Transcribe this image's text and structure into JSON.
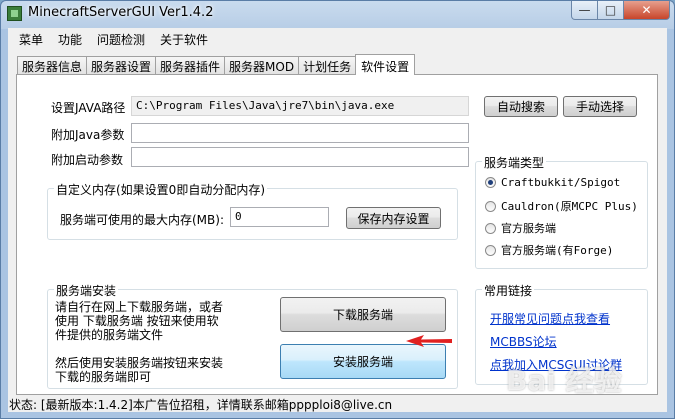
{
  "window": {
    "title": "MinecraftServerGUI Ver1.4.2",
    "buttons": {
      "minimize": "—",
      "maximize": "□",
      "close": "✕"
    }
  },
  "menu": [
    "菜单",
    "功能",
    "问题检测",
    "关于软件"
  ],
  "tabs": [
    {
      "label": "服务器信息",
      "active": false
    },
    {
      "label": "服务器设置",
      "active": false
    },
    {
      "label": "服务器插件",
      "active": false
    },
    {
      "label": "服务器MOD",
      "active": false
    },
    {
      "label": "计划任务",
      "active": false
    },
    {
      "label": "软件设置",
      "active": true
    }
  ],
  "java": {
    "path_label": "设置JAVA路径",
    "path_value": "C:\\Program Files\\Java\\jre7\\bin\\java.exe",
    "auto_search": "自动搜索",
    "manual_select": "手动选择",
    "java_args_label": "附加Java参数",
    "java_args_value": "",
    "start_args_label": "附加启动参数",
    "start_args_value": ""
  },
  "memory": {
    "group_title": "自定义内存(如果设置0即自动分配内存)",
    "max_label": "服务端可使用的最大内存(MB):",
    "max_value": "0",
    "save_button": "保存内存设置"
  },
  "server_type": {
    "group_title": "服务端类型",
    "options": [
      {
        "label": "Craftbukkit/Spigot",
        "selected": true
      },
      {
        "label": "Cauldron(原MCPC Plus)",
        "selected": false
      },
      {
        "label": "官方服务端",
        "selected": false
      },
      {
        "label": "官方服务端(有Forge)",
        "selected": false
      }
    ]
  },
  "install": {
    "group_title": "服务端安装",
    "desc1_line1": "请自行在网上下载服务端，或者",
    "desc1_line2": "使用  下载服务端   按钮来使用软",
    "desc1_line3": "件提供的服务端文件",
    "desc2_line1": "然后使用安装服务端按钮来安装",
    "desc2_line2": "下载的服务端即可",
    "download_button": "下载服务端",
    "install_button": "安装服务端"
  },
  "links": {
    "group_title": "常用链接",
    "items": [
      "开服常见问题点我查看",
      "MCBBS论坛",
      "点我加入MCSGUI讨论群"
    ]
  },
  "status": "状态: [最新版本:1.4.2]本广告位招租，详情联系邮箱pppploi8@live.cn",
  "watermark": "Bai 经验",
  "colors": {
    "arrow": "#e02020",
    "link": "#0033cc"
  }
}
